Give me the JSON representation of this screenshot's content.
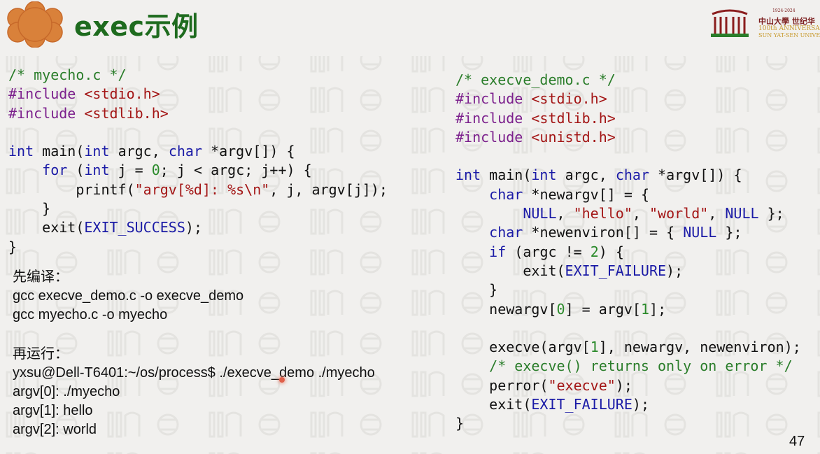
{
  "header": {
    "title": "exec示例",
    "logo_years": "1924-2024",
    "logo_name_cn": "中山大學 世纪华",
    "logo_anniversary": "100th ANNIVERSA",
    "logo_name_en": "SUN YAT-SEN UNIVERSITY"
  },
  "code_left": {
    "lines": [
      "/* myecho.c */",
      "#include <stdio.h>",
      "#include <stdlib.h>",
      "",
      "int main(int argc, char *argv[]) {",
      "    for (int j = 0; j < argc; j++) {",
      "        printf(\"argv[%d]: %s\\n\", j, argv[j]);",
      "    }",
      "    exit(EXIT_SUCCESS);",
      "}"
    ]
  },
  "code_right": {
    "lines": [
      "/* execve_demo.c */",
      "#include <stdio.h>",
      "#include <stdlib.h>",
      "#include <unistd.h>",
      "",
      "int main(int argc, char *argv[]) {",
      "    char *newargv[] = {",
      "        NULL, \"hello\", \"world\", NULL };",
      "    char *newenviron[] = { NULL };",
      "    if (argc != 2) {",
      "        exit(EXIT_FAILURE);",
      "    }",
      "    newargv[0] = argv[1];",
      "",
      "    execve(argv[1], newargv, newenviron);",
      "    /* execve() returns only on error */",
      "    perror(\"execve\");",
      "    exit(EXIT_FAILURE);",
      "}"
    ]
  },
  "notes": {
    "compile_heading": "先编译：",
    "compile_cmd_1": "gcc execve_demo.c -o execve_demo",
    "compile_cmd_2": "gcc myecho.c -o myecho",
    "run_heading": "再运行：",
    "run_cmd": "yxsu@Dell-T6401:~/os/process$ ./execve_demo ./myecho",
    "output_1": "argv[0]: ./myecho",
    "output_2": "argv[1]: hello",
    "output_3": "argv[2]: world"
  },
  "footer": {
    "page_number": "47"
  }
}
